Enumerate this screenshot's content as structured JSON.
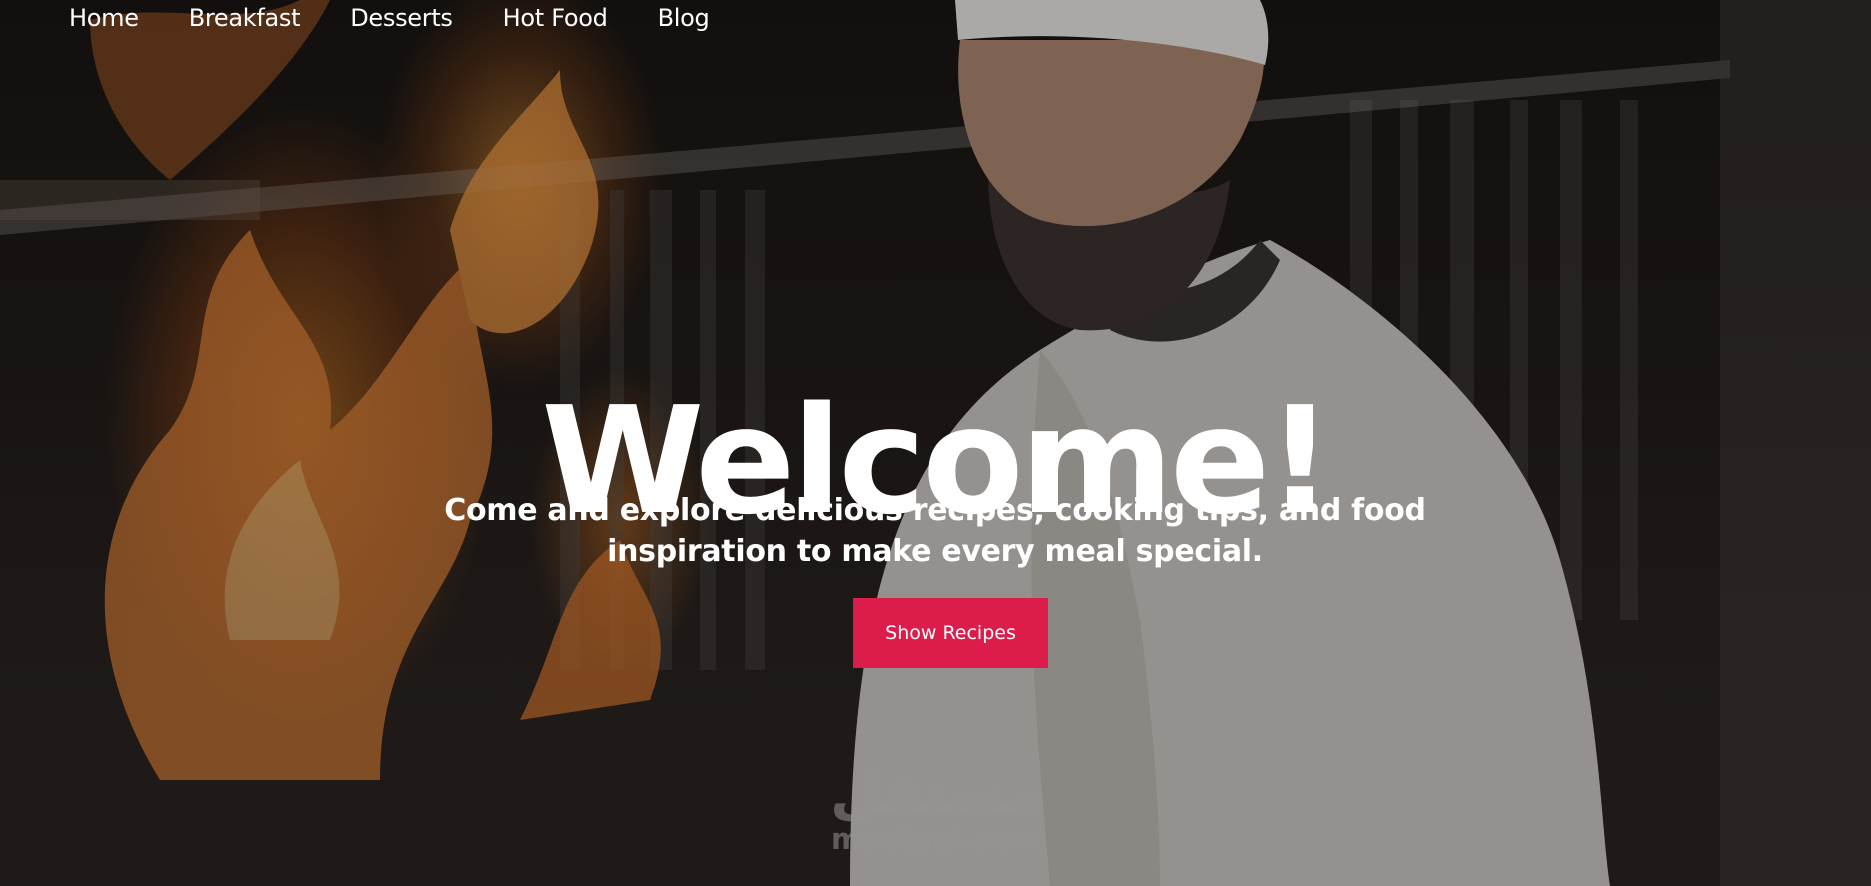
{
  "nav": {
    "items": [
      {
        "label": "Home"
      },
      {
        "label": "Breakfast"
      },
      {
        "label": "Desserts"
      },
      {
        "label": "Hot Food"
      },
      {
        "label": "Blog"
      }
    ]
  },
  "hero": {
    "title": "Welcome!",
    "tagline_line1": "Come and explore delicious recipes, cooking tips, and food",
    "tagline_line2": "inspiration to make every meal special.",
    "cta_label": "Show Recipes"
  },
  "watermark": {
    "arabic": "مستقل",
    "domain": "mostaql.com"
  },
  "colors": {
    "accent": "#dc1c4b",
    "text": "#ffffff"
  },
  "icons": [
    "hero-background-image"
  ]
}
